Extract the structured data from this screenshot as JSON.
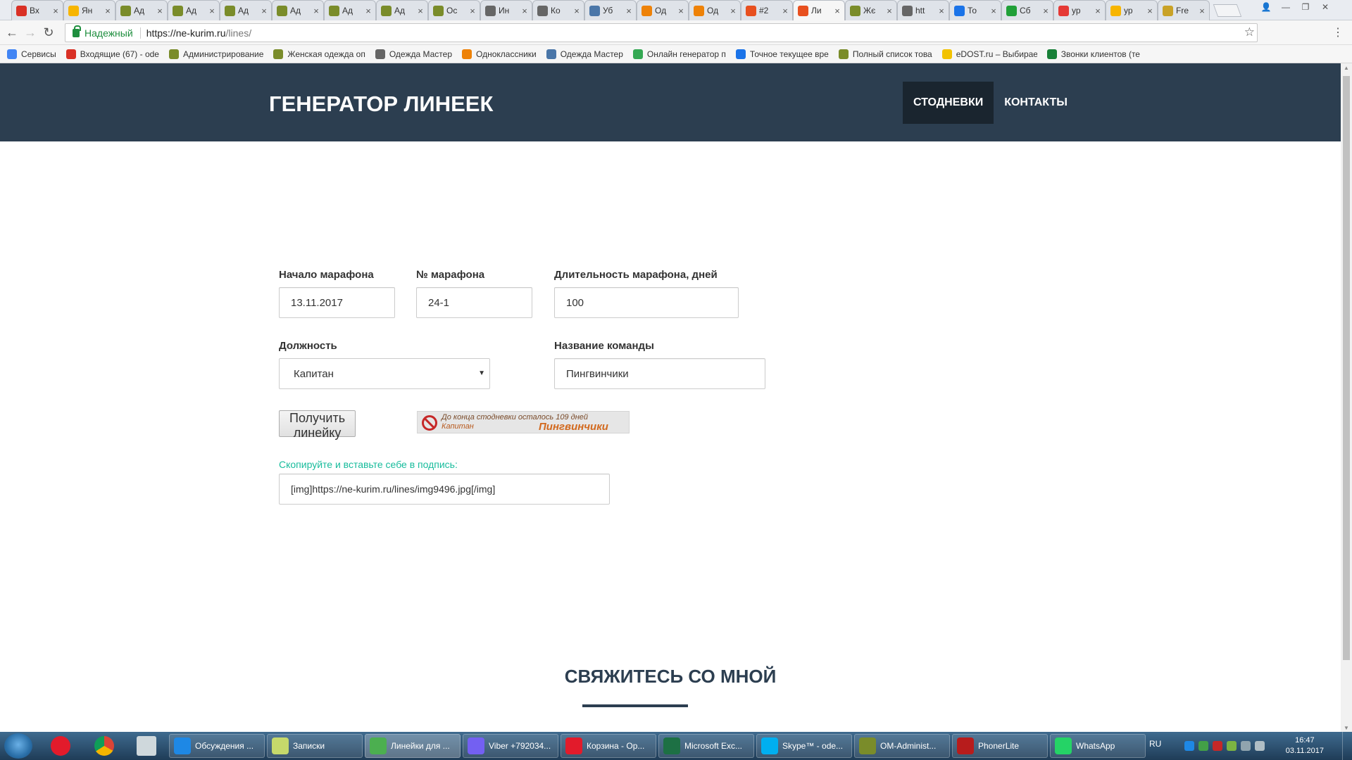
{
  "browser": {
    "tabs": [
      {
        "label": "Вх",
        "icon": "gmail-icon",
        "color": "#d93025"
      },
      {
        "label": "Ян",
        "icon": "yandex-mail-icon",
        "color": "#f7b500"
      },
      {
        "label": "Ад",
        "icon": "admin-icon",
        "color": "#7a8c2a"
      },
      {
        "label": "Ад",
        "icon": "admin-icon",
        "color": "#7a8c2a"
      },
      {
        "label": "Ад",
        "icon": "admin-icon",
        "color": "#7a8c2a"
      },
      {
        "label": "Ад",
        "icon": "admin-icon",
        "color": "#7a8c2a"
      },
      {
        "label": "Ад",
        "icon": "admin-icon",
        "color": "#7a8c2a"
      },
      {
        "label": "Ад",
        "icon": "admin-icon",
        "color": "#7a8c2a"
      },
      {
        "label": "Ос",
        "icon": "admin-icon",
        "color": "#7a8c2a"
      },
      {
        "label": "Ин",
        "icon": "phone-icon",
        "color": "#666666"
      },
      {
        "label": "Ко",
        "icon": "phone-icon",
        "color": "#666666"
      },
      {
        "label": "Уб",
        "icon": "vk-icon",
        "color": "#4a76a8"
      },
      {
        "label": "Од",
        "icon": "odnoklassniki-icon",
        "color": "#ee8208"
      },
      {
        "label": "Од",
        "icon": "odnoklassniki-icon",
        "color": "#ee8208"
      },
      {
        "label": "#2",
        "icon": "mail-icon",
        "color": "#e8501f"
      },
      {
        "label": "Ли",
        "icon": "ruler-icon",
        "color": "#e8501f",
        "active": true
      },
      {
        "label": "Жє",
        "icon": "admin-icon",
        "color": "#7a8c2a"
      },
      {
        "label": "htt",
        "icon": "phone-icon",
        "color": "#666666"
      },
      {
        "label": "То",
        "icon": "clock-icon",
        "color": "#1a73e8"
      },
      {
        "label": "Сб",
        "icon": "sberbank-icon",
        "color": "#21a038"
      },
      {
        "label": "ур",
        "icon": "yandex-icon",
        "color": "#e53935"
      },
      {
        "label": "ур",
        "icon": "yandex-icon",
        "color": "#f7b500"
      },
      {
        "label": "Fre",
        "icon": "free-icon",
        "color": "#c9a227"
      }
    ],
    "address": {
      "secure_label": "Надежный",
      "url_host": "https://ne-kurim.ru",
      "url_path": "/lines/"
    },
    "bookmarks": [
      {
        "label": "Сервисы",
        "icon": "apps-icon",
        "color": "#4285f4"
      },
      {
        "label": "Входящие (67) - ode",
        "icon": "gmail-icon",
        "color": "#d93025"
      },
      {
        "label": "Администрирование",
        "icon": "admin-icon",
        "color": "#7a8c2a"
      },
      {
        "label": "Женская одежда оп",
        "icon": "admin-icon",
        "color": "#7a8c2a"
      },
      {
        "label": "Одежда Мастер",
        "icon": "phone-icon",
        "color": "#666666"
      },
      {
        "label": "Одноклассники",
        "icon": "odnoklassniki-icon",
        "color": "#ee8208"
      },
      {
        "label": "Одежда Мастер",
        "icon": "vk-icon",
        "color": "#4a76a8"
      },
      {
        "label": "Онлайн генератор п",
        "icon": "globe-icon",
        "color": "#34a853"
      },
      {
        "label": "Точное текущее вре",
        "icon": "clock-icon",
        "color": "#1a73e8"
      },
      {
        "label": "Полный список това",
        "icon": "admin-icon",
        "color": "#7a8c2a"
      },
      {
        "label": "eDOST.ru – Выбирае",
        "icon": "envelope-icon",
        "color": "#f2c200"
      },
      {
        "label": "Звонки клиентов (те",
        "icon": "sheet-icon",
        "color": "#188038"
      }
    ]
  },
  "site": {
    "logo": "ГЕНЕРАТОР ЛИНЕЕК",
    "nav": [
      {
        "label": "СТОДНЕВКИ",
        "active": true
      },
      {
        "label": "КОНТАКТЫ",
        "active": false
      }
    ],
    "form": {
      "start_label": "Начало марафона",
      "start_value": "13.11.2017",
      "number_label": "№ марафона",
      "number_value": "24-1",
      "duration_label": "Длительность марафона, дней",
      "duration_value": "100",
      "position_label": "Должность",
      "position_value": "Капитан",
      "team_label": "Название команды",
      "team_value": "Пингвинчики",
      "submit_label": "Получить линейку",
      "banner_line1": "До конца стодневки осталось 109 дней",
      "banner_line2": "Капитан",
      "banner_team": "Пингвинчики",
      "copy_hint": "Скопируйте и вставьте себе в подпись:",
      "copy_value": "[img]https://ne-kurim.ru/lines/img9496.jpg[/img]"
    },
    "contact_title": "СВЯЖИТЕСЬ СО МНОЙ"
  },
  "taskbar": {
    "items": [
      {
        "label": "Обсуждения ...",
        "icon": "ie-icon",
        "color": "#1e88e5"
      },
      {
        "label": "Записки",
        "icon": "notes-icon",
        "color": "#c6d96b"
      },
      {
        "label": "Линейки для ...",
        "icon": "chrome-icon",
        "color": "#4caf50",
        "active": true
      },
      {
        "label": "Viber +792034...",
        "icon": "viber-icon",
        "color": "#7360f2"
      },
      {
        "label": "Корзина - Op...",
        "icon": "opera-icon",
        "color": "#e21b2b"
      },
      {
        "label": "Microsoft Exc...",
        "icon": "excel-icon",
        "color": "#1d7044"
      },
      {
        "label": "Skype™ - ode...",
        "icon": "skype-icon",
        "color": "#00aff0"
      },
      {
        "label": "OM-Administ...",
        "icon": "admin-icon",
        "color": "#7a8c2a"
      },
      {
        "label": "PhonerLite",
        "icon": "phonerlite-icon",
        "color": "#b71c1c"
      },
      {
        "label": "WhatsApp",
        "icon": "whatsapp-icon",
        "color": "#25d366"
      }
    ],
    "lang": "RU",
    "time": "16:47",
    "date": "03.11.2017"
  }
}
